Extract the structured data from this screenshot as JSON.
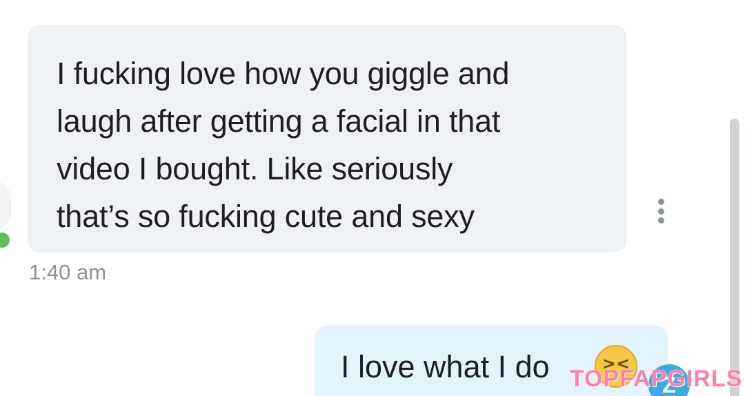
{
  "incoming": {
    "lines": [
      "I fucking love how you giggle and",
      "laugh after getting a facial in that",
      "video I bought. Like seriously",
      "that’s so fucking cute and sexy"
    ],
    "timestamp": "1:40 am"
  },
  "outgoing": {
    "text": "I love what I do",
    "emoji": "😣"
  },
  "watermark": "TOPFAPGIRLS",
  "colors": {
    "incoming_bubble": "#eff2f4",
    "outgoing_bubble": "#e3f3fb",
    "online": "#5cc05a",
    "status_icon": "#3fa9e0",
    "watermark": "#ff7fa9"
  },
  "icons": {
    "more": "more-vertical-icon",
    "online": "online-status-icon",
    "status": "status-icon"
  }
}
